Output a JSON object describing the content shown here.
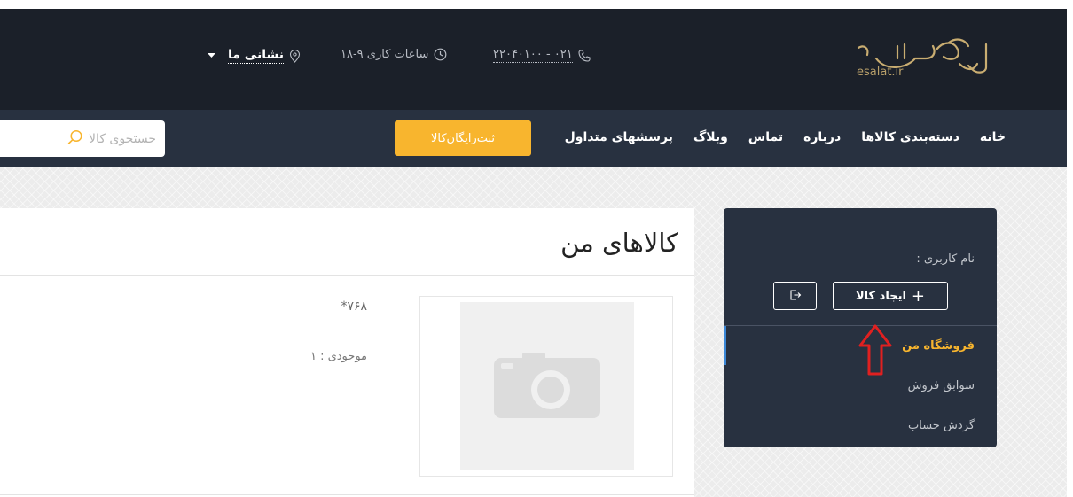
{
  "header": {
    "logo": {
      "mark": "اصالت",
      "domain": "esalat.ir"
    },
    "phone": "۰۲۱ - ۲۲۰۴۰۱۰۰",
    "hours": "ساعات کاری ۹-۱۸",
    "address": "نشانی ما"
  },
  "nav": {
    "items": [
      {
        "label": "خانه"
      },
      {
        "label": "دسته‌بندی کالاها"
      },
      {
        "label": "درباره"
      },
      {
        "label": "تماس"
      },
      {
        "label": "وبلاگ"
      },
      {
        "label": "پرسشهای متداول"
      }
    ],
    "cta_label": "ثبت‌رایگان‌کالا",
    "search_placeholder": "جستجوی کالا"
  },
  "sidebar": {
    "username_label": "نام کاربری :",
    "create_product_label": "ایجاد کالا",
    "menu": [
      {
        "label": "فروشگاه من",
        "active": true
      },
      {
        "label": "سوابق فروش",
        "active": false
      },
      {
        "label": "گردش حساب",
        "active": false
      }
    ]
  },
  "main": {
    "title": "کالاهای من",
    "product": {
      "price": "۷۶۸*",
      "stock": "موجودی : ۱"
    }
  },
  "colors": {
    "header_bg": "#1b2029",
    "nav_bg": "#283140",
    "accent": "#f8b52e",
    "active_indicator": "#3b87d6",
    "annotation_arrow": "#e02020"
  }
}
